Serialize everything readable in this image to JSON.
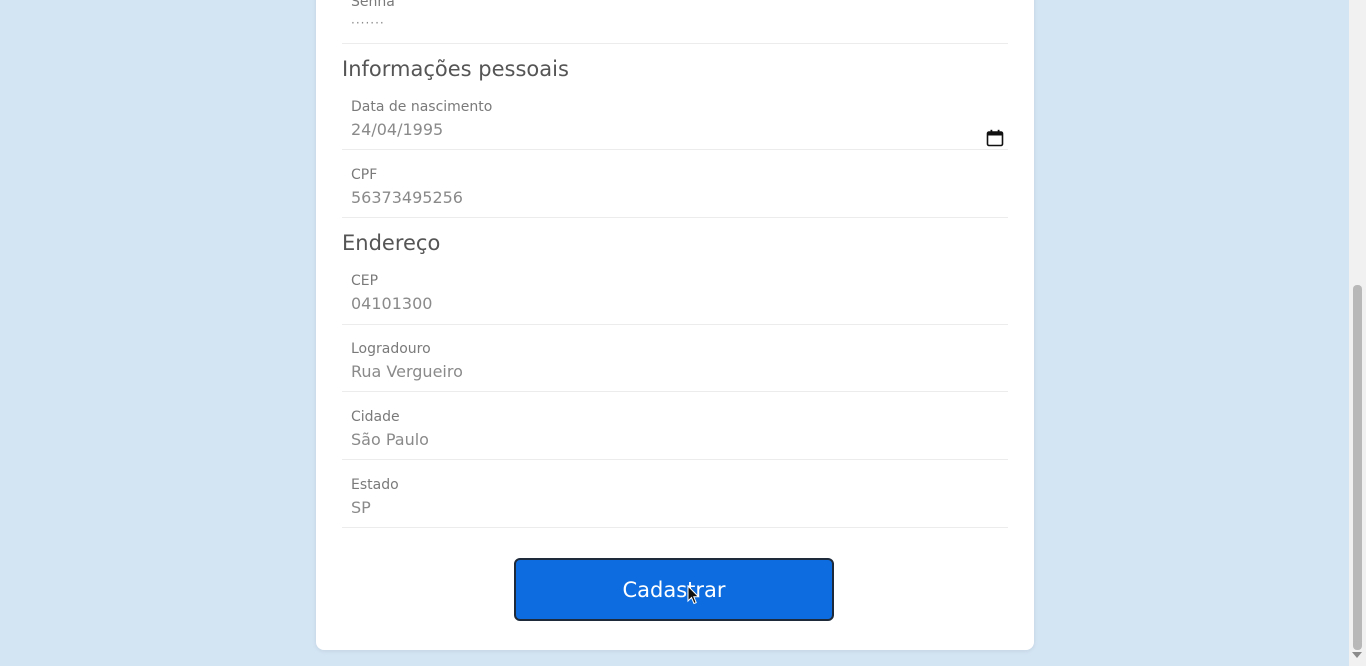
{
  "form": {
    "senha": {
      "label": "Senha",
      "value": "·······"
    },
    "personal_section_title": "Informações pessoais",
    "birthdate": {
      "label": "Data de nascimento",
      "value": "24/04/1995"
    },
    "cpf": {
      "label": "CPF",
      "value": "56373495256"
    },
    "address_section_title": "Endereço",
    "cep": {
      "label": "CEP",
      "value": "04101300"
    },
    "logradouro": {
      "label": "Logradouro",
      "value": "Rua Vergueiro"
    },
    "cidade": {
      "label": "Cidade",
      "value": "São Paulo"
    },
    "estado": {
      "label": "Estado",
      "value": "SP"
    },
    "submit_label": "Cadastrar"
  },
  "icons": {
    "calendar": "calendar-icon",
    "cursor": "mouse-pointer-icon"
  },
  "colors": {
    "page_background": "#d3e4f3",
    "card_background": "#ffffff",
    "button_background": "#0d6de0",
    "button_text": "#ffffff"
  }
}
